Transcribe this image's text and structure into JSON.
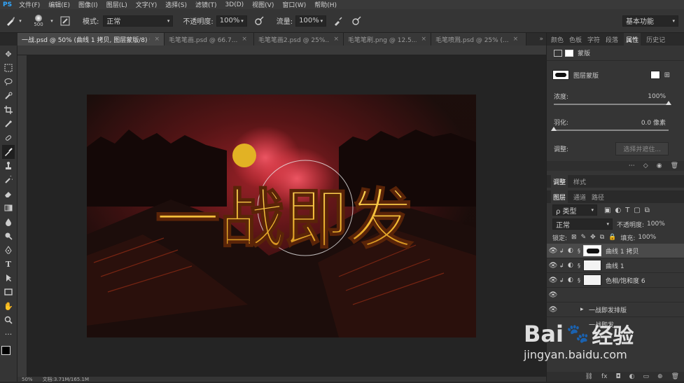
{
  "app": {
    "logo": "PS"
  },
  "menu": [
    "文件(F)",
    "编辑(E)",
    "图像(I)",
    "图层(L)",
    "文字(Y)",
    "选择(S)",
    "滤镜(T)",
    "3D(D)",
    "视图(V)",
    "窗口(W)",
    "帮助(H)"
  ],
  "options": {
    "brush_size": "500",
    "mode_label": "模式:",
    "mode_value": "正常",
    "opacity_label": "不透明度:",
    "opacity_value": "100%",
    "flow_label": "流量:",
    "flow_value": "100%",
    "workspace": "基本功能"
  },
  "tabs": [
    {
      "label": "一战.psd @ 50% (曲线 1 拷贝, 图层蒙版/8) *",
      "active": true
    },
    {
      "label": "毛笔笔画.psd @ 66.7..."
    },
    {
      "label": "毛笔笔画2.psd @ 25%..."
    },
    {
      "label": "毛笔笔刷.png @ 12.5..."
    },
    {
      "label": "毛笔喷溅.psd @ 25% (..."
    }
  ],
  "artwork": {
    "headline": "一战即发"
  },
  "status": {
    "zoom": "50%",
    "doc": "文档:3.71M/165.1M"
  },
  "props": {
    "tabs": [
      "颜色",
      "色板",
      "字符",
      "段落",
      "属性",
      "历史记"
    ],
    "header": "蒙版",
    "layer_mask": "图层蒙版",
    "density_label": "浓度:",
    "density_value": "100%",
    "feather_label": "羽化:",
    "feather_value": "0.0 像素",
    "refine_label": "调整:",
    "refine_button": "选择并遮住..."
  },
  "adjust_tabs": [
    "调整",
    "样式"
  ],
  "layers": {
    "tabs": [
      "图层",
      "通道",
      "路径"
    ],
    "filter": "ρ 类型",
    "blend": "正常",
    "opacity_label": "不透明度:",
    "opacity_value": "100%",
    "lock_label": "锁定:",
    "fill_label": "填充:",
    "fill_value": "100%",
    "rows": [
      {
        "name": "曲线 1 拷贝"
      },
      {
        "name": "曲线 1"
      },
      {
        "name": "色相/饱和度 6"
      },
      {
        "name": ""
      },
      {
        "name": "一战即发排版"
      },
      {
        "name": "一战即发"
      }
    ]
  },
  "watermark": {
    "brand": "Bai",
    "cn": "经验",
    "url": "jingyan.baidu.com"
  },
  "colors": {
    "accent": "#31a8ff",
    "panel": "#353535",
    "canvas_bg": "#242424",
    "gold": "#f2c234"
  }
}
